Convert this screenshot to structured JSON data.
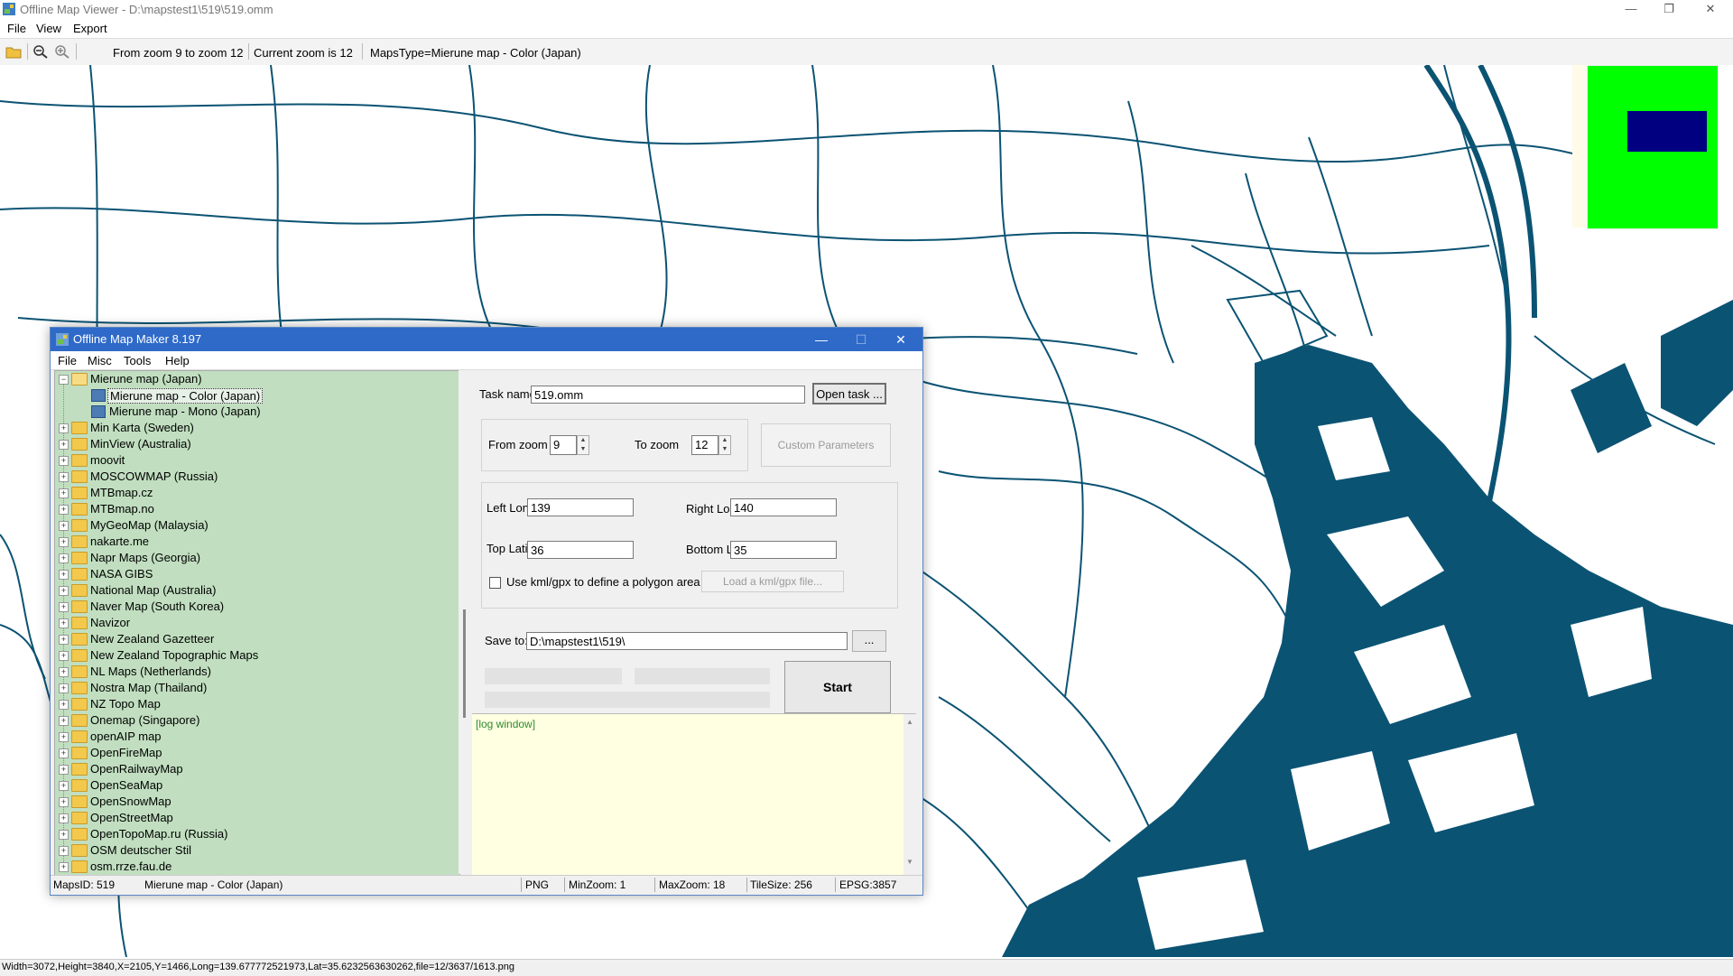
{
  "viewer": {
    "title": "Offline Map Viewer - D:\\mapstest1\\519\\519.omm",
    "menu": [
      "File",
      "View",
      "Export"
    ],
    "toolbar": {
      "zoom_range": "From zoom 9 to zoom 12",
      "current_zoom": "Current zoom is 12",
      "maps_type": "MapsType=Mierune map - Color (Japan)"
    },
    "window_buttons": {
      "minimize": "—",
      "restore": "❐",
      "close": "✕"
    },
    "status": "Width=3072,Height=3840,X=2105,Y=1466,Long=139.677772521973,Lat=35.6232563630262,file=12/3637/1613.png"
  },
  "colors": {
    "map_water": "#0b5373",
    "minimap_bg": "#00ff00",
    "minimap_viewport": "#000080",
    "tree_bg": "#c1dfc0",
    "log_bg": "#ffffe1",
    "dialog_title": "#2f6ac9"
  },
  "dialog": {
    "title": "Offline Map Maker 8.197",
    "buttons": {
      "minimize": "—",
      "maximize": "☐",
      "close": "✕"
    },
    "menu": [
      "File",
      "Misc",
      "Tools",
      "Help"
    ],
    "tree": {
      "expanded": {
        "label": "Mierune map (Japan)",
        "children": [
          "Mierune map - Color (Japan)",
          "Mierune map - Mono (Japan)"
        ],
        "selected": "Mierune map - Color (Japan)"
      },
      "items": [
        "Min Karta (Sweden)",
        "MinView (Australia)",
        "moovit",
        "MOSCOWMAP (Russia)",
        "MTBmap.cz",
        "MTBmap.no",
        "MyGeoMap (Malaysia)",
        "nakarte.me",
        "Napr Maps (Georgia)",
        "NASA GIBS",
        "National Map (Australia)",
        "Naver Map (South Korea)",
        "Navizor",
        "New Zealand Gazetteer",
        "New Zealand Topographic Maps",
        "NL Maps (Netherlands)",
        "Nostra Map (Thailand)",
        "NZ Topo Map",
        "Onemap (Singapore)",
        "openAIP map",
        "OpenFireMap",
        "OpenRailwayMap",
        "OpenSeaMap",
        "OpenSnowMap",
        "OpenStreetMap",
        "OpenTopoMap.ru (Russia)",
        "OSM deutscher Stil",
        "osm.rrze.fau.de"
      ]
    },
    "form": {
      "task_name_label": "Task name",
      "task_name": "519.omm",
      "open_task": "Open task ...",
      "from_zoom_label": "From zoom",
      "from_zoom": "9",
      "to_zoom_label": "To zoom",
      "to_zoom": "12",
      "custom_params": "Custom Parameters",
      "left_lon_label": "Left Longitude",
      "left_lon": "139",
      "right_lon_label": "Right Longitude",
      "right_lon": "140",
      "top_lat_label": "Top Latitude",
      "top_lat": "36",
      "bottom_lat_label": "Bottom Latitude",
      "bottom_lat": "35",
      "kml_checkbox": "Use kml/gpx to define a polygon area",
      "kml_checked": false,
      "load_kml": "Load a kml/gpx file...",
      "save_to_label": "Save to:",
      "save_to": "D:\\mapstest1\\519\\",
      "browse": "...",
      "start": "Start"
    },
    "log": "[log window]",
    "status": {
      "maps_id": "MapsID: 519",
      "map_name": "Mierune map - Color (Japan)",
      "format": "PNG",
      "min_zoom": "MinZoom: 1",
      "max_zoom": "MaxZoom: 18",
      "tile_size": "TileSize: 256",
      "epsg": "EPSG:3857"
    }
  }
}
